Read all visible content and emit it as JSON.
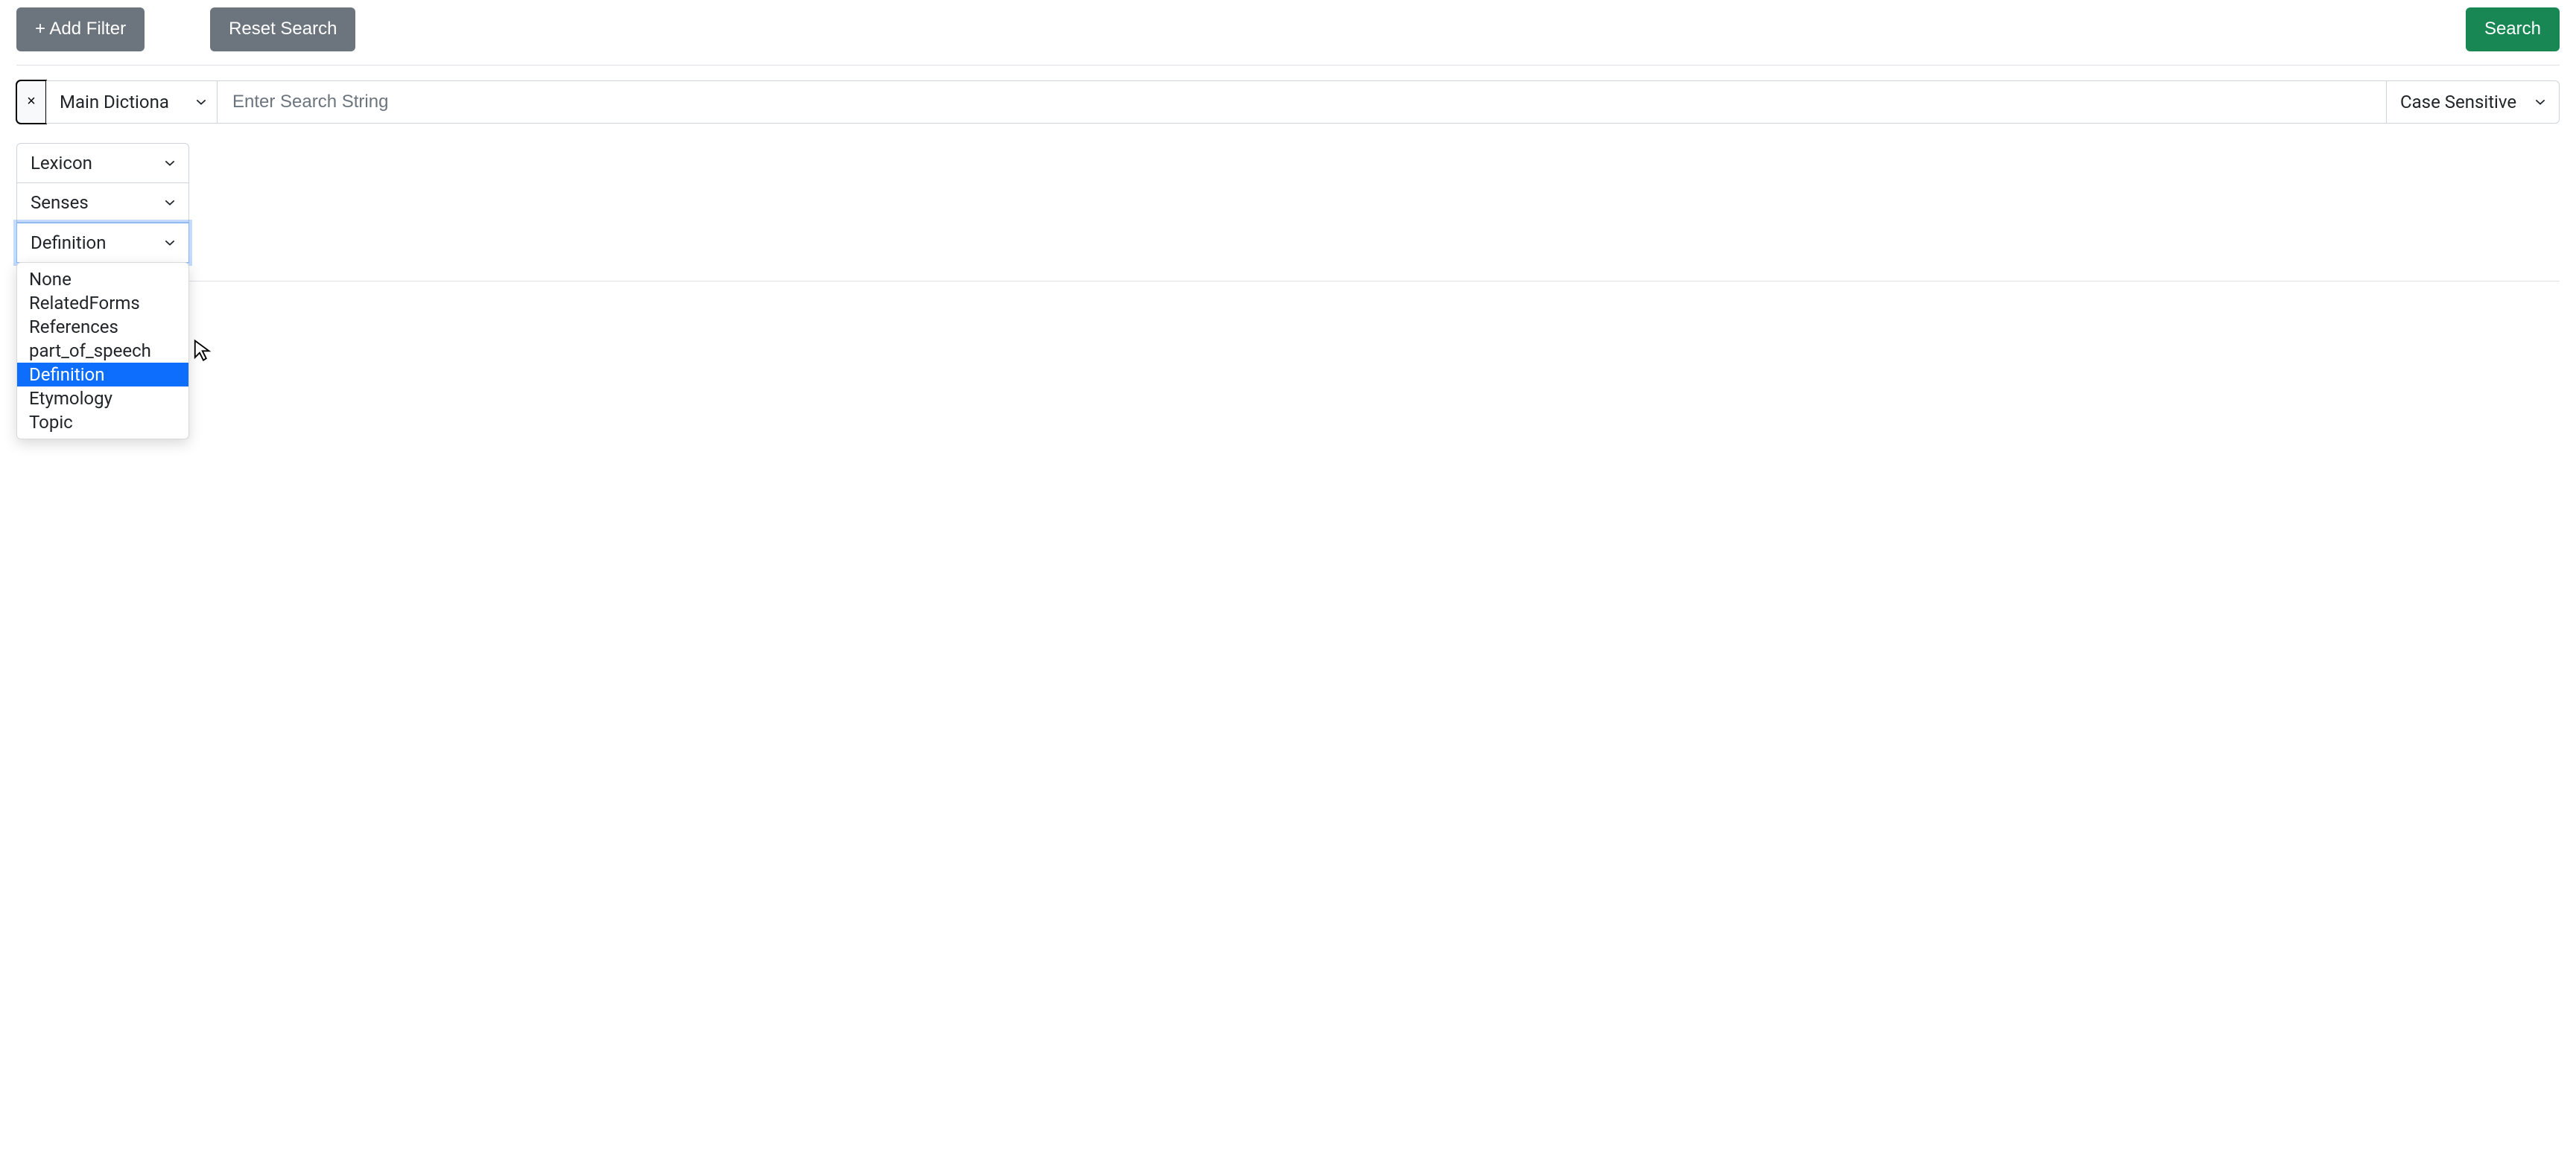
{
  "toolbar": {
    "add_filter_label": "+ Add Filter",
    "reset_label": "Reset Search",
    "search_label": "Search"
  },
  "filter": {
    "close_glyph": "×",
    "dictionary_selected": "Main Dictiona",
    "search_placeholder": "Enter Search String",
    "case_label": "Case Sensitive"
  },
  "path_selects": {
    "level1": "Lexicon",
    "level2": "Senses",
    "level3": "Definition"
  },
  "dropdown": {
    "options": [
      "None",
      "RelatedForms",
      "References",
      "part_of_speech",
      "Definition",
      "Etymology",
      "Topic"
    ],
    "selected_index": 4
  }
}
